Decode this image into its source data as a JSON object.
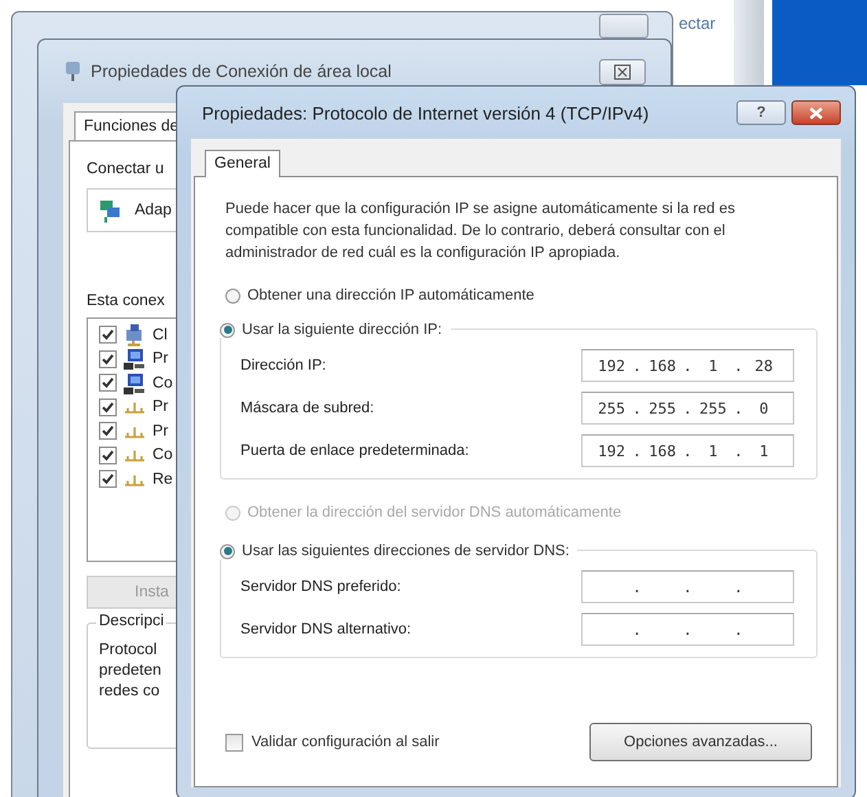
{
  "background": {
    "partial_text": "ectar"
  },
  "connection_properties": {
    "title": "Propiedades de Conexión de área local",
    "tab": "Funciones de",
    "connect_label": "Conectar u",
    "adapter": "Adap",
    "list_label": "Esta conex",
    "components": [
      {
        "label": "Cl",
        "checked": true,
        "kind": "client"
      },
      {
        "label": "Pr",
        "checked": true,
        "kind": "computer"
      },
      {
        "label": "Co",
        "checked": true,
        "kind": "computer"
      },
      {
        "label": "Pr",
        "checked": true,
        "kind": "protocol"
      },
      {
        "label": "Pr",
        "checked": true,
        "kind": "protocol"
      },
      {
        "label": "Co",
        "checked": true,
        "kind": "protocol"
      },
      {
        "label": "Re",
        "checked": true,
        "kind": "protocol"
      }
    ],
    "install_button": "Insta",
    "description_label": "Descripci",
    "description_lines": [
      "Protocol",
      "predeten",
      "redes co"
    ]
  },
  "ipv4_properties": {
    "title": "Propiedades: Protocolo de Internet versión 4 (TCP/IPv4)",
    "help_button": "?",
    "tabs": [
      {
        "label": "General",
        "selected": true
      }
    ],
    "intro": "Puede hacer que la configuración IP se asigne automáticamente si la red es compatible con esta funcionalidad. De lo contrario, deberá consultar con el administrador de red cuál es la configuración IP apropiada.",
    "separator": ".",
    "ip_mode": [
      {
        "label": "Obtener una dirección IP automáticamente",
        "selected": false
      },
      {
        "label": "Usar la siguiente dirección IP:",
        "selected": true
      }
    ],
    "ip_fields": [
      {
        "label": "Dirección IP:",
        "octets": [
          "192",
          "168",
          "1",
          "28"
        ]
      },
      {
        "label": "Máscara de subred:",
        "octets": [
          "255",
          "255",
          "255",
          "0"
        ]
      },
      {
        "label": "Puerta de enlace predeterminada:",
        "octets": [
          "192",
          "168",
          "1",
          "1"
        ]
      }
    ],
    "dns_mode": [
      {
        "label": "Obtener la dirección del servidor DNS automáticamente",
        "selected": false,
        "disabled": true
      },
      {
        "label": "Usar las siguientes direcciones de servidor DNS:",
        "selected": true,
        "disabled": false
      }
    ],
    "dns_fields": [
      {
        "label": "Servidor DNS preferido:"
      },
      {
        "label": "Servidor DNS alternativo:"
      }
    ],
    "validate": {
      "label": "Validar configuración al salir",
      "checked": false
    },
    "advanced_button": "Opciones avanzadas..."
  }
}
